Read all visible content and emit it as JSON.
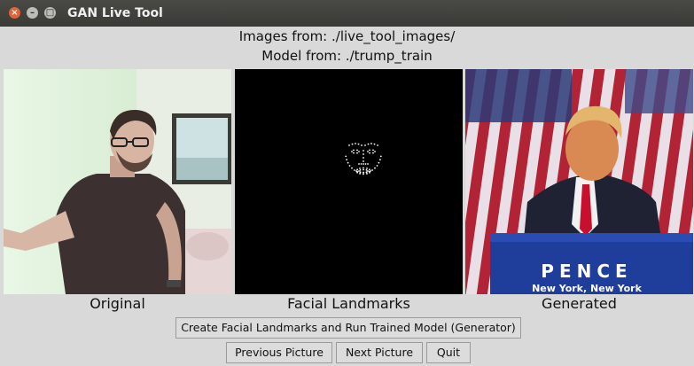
{
  "window": {
    "title": "GAN Live Tool",
    "controls": [
      "close",
      "minimize",
      "maximize"
    ]
  },
  "info": {
    "images_line": "Images from: ./live_tool_images/",
    "model_line": "Model from: ./trump_train"
  },
  "panels": [
    {
      "id": "original",
      "caption": "Original"
    },
    {
      "id": "landmarks",
      "caption": "Facial Landmarks"
    },
    {
      "id": "generated",
      "caption": "Generated"
    }
  ],
  "banner_text": {
    "line1": "PENCE",
    "line2": "New York, New York"
  },
  "buttons": {
    "run_model": "Create Facial Landmarks and Run Trained Model (Generator)",
    "previous": "Previous Picture",
    "next": "Next Picture",
    "quit": "Quit"
  },
  "icons": {
    "close": "×",
    "minimize": "–",
    "maximize": "□"
  }
}
